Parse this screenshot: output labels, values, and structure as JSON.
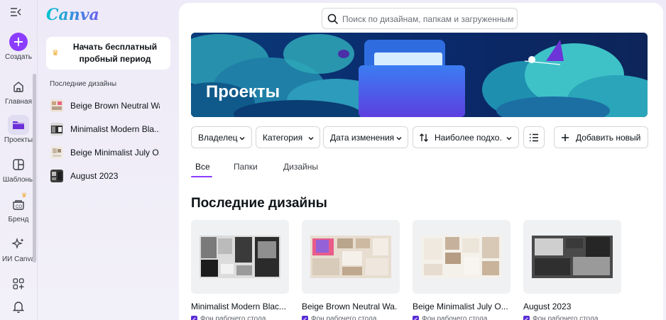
{
  "app": {
    "logo": "Canva"
  },
  "rail": {
    "create_label": "Создать",
    "items": [
      {
        "label": "Главная",
        "icon": "home-icon"
      },
      {
        "label": "Проекты",
        "icon": "folder-icon"
      },
      {
        "label": "Шаблоны",
        "icon": "templates-icon"
      },
      {
        "label": "Бренд",
        "icon": "brand-icon"
      },
      {
        "label": "ИИ Canva",
        "icon": "sparkle-icon"
      }
    ]
  },
  "side": {
    "trial_label": "Начать бесплатный пробный период",
    "recent_title": "Последние дизайны",
    "recent": [
      {
        "name": "Beige Brown Neutral Wa..."
      },
      {
        "name": "Minimalist Modern Bla..."
      },
      {
        "name": "Beige Minimalist July O..."
      },
      {
        "name": "August 2023"
      }
    ]
  },
  "search": {
    "placeholder": "Поиск по дизайнам, папкам и загруженным ф",
    "value": ""
  },
  "hero": {
    "title": "Проекты"
  },
  "filters": {
    "owner": "Владелец",
    "category": "Категория",
    "date": "Дата изменения",
    "sort": "Наиболее подхо...",
    "add_new": "Добавить новый"
  },
  "tabs": [
    {
      "label": "Все",
      "active": true
    },
    {
      "label": "Папки",
      "active": false
    },
    {
      "label": "Дизайны",
      "active": false
    }
  ],
  "section_title": "Последние дизайны",
  "designs": [
    {
      "title": "Minimalist Modern Blac...",
      "type": "Фон рабочего стола"
    },
    {
      "title": "Beige Brown Neutral Wa...",
      "type": "Фон рабочего стола"
    },
    {
      "title": "Beige Minimalist July O...",
      "type": "Фон рабочего стола"
    },
    {
      "title": "August 2023",
      "type": "Фон рабочего стола"
    }
  ],
  "colors": {
    "accent": "#8b3dff",
    "hero_bg": "#0d2a63"
  }
}
